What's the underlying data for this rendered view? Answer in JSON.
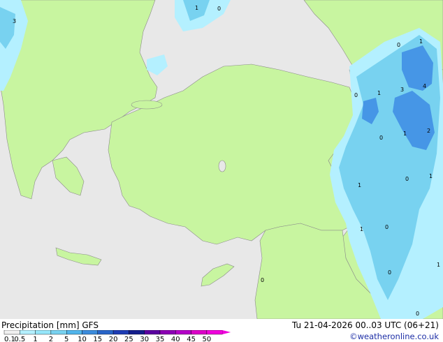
{
  "map": {
    "point_values": [
      {
        "label": "3",
        "lon_lat_hint": "north-west corner"
      },
      {
        "label": "1",
        "lon_lat_hint": "black sea west"
      },
      {
        "label": "0",
        "lon_lat_hint": "black sea west"
      },
      {
        "label": "0",
        "lon_lat_hint": "caucasus"
      },
      {
        "label": "1",
        "lon_lat_hint": "caucasus"
      },
      {
        "label": "1",
        "lon_lat_hint": "caucasus"
      },
      {
        "label": "3",
        "lon_lat_hint": "caucasus"
      },
      {
        "label": "4",
        "lon_lat_hint": "caucasus"
      },
      {
        "label": "0",
        "lon_lat_hint": "eastern turkey"
      },
      {
        "label": "2",
        "lon_lat_hint": "caspian"
      },
      {
        "label": "1",
        "lon_lat_hint": "armenia"
      },
      {
        "label": "0",
        "lon_lat_hint": "armenia"
      },
      {
        "label": "0",
        "lon_lat_hint": "iran"
      },
      {
        "label": "1",
        "lon_lat_hint": "iran"
      },
      {
        "label": "1",
        "lon_lat_hint": "iraq"
      },
      {
        "label": "1",
        "lon_lat_hint": "iraq"
      },
      {
        "label": "0",
        "lon_lat_hint": "iraq"
      },
      {
        "label": "0",
        "lon_lat_hint": "levant"
      },
      {
        "label": "0",
        "lon_lat_hint": "iraq south"
      },
      {
        "label": "1",
        "lon_lat_hint": "iran south"
      },
      {
        "label": "0",
        "lon_lat_hint": "south-east corner"
      }
    ],
    "colors": {
      "sea": "#e8e8e8",
      "land": "#c8f5a0",
      "precip_light": "#b4f0ff",
      "precip_mid": "#78d2f0",
      "precip_heavy": "#4696e6"
    }
  },
  "footer": {
    "title": "Precipitation [mm]  GFS",
    "datetime": "Tu 21-04-2026 00..03 UTC (06+21)",
    "credit": "©weatheronline.co.uk",
    "scale_labels": [
      "0.1",
      "0.5",
      "1",
      "2",
      "5",
      "10",
      "15",
      "20",
      "25",
      "30",
      "35",
      "40",
      "45",
      "50"
    ],
    "scale_colors": [
      "#f0f0f0",
      "#b4f0ff",
      "#96e6fa",
      "#78d2f0",
      "#50b4eb",
      "#3c8cdc",
      "#2864c8",
      "#1e3cb4",
      "#141e8c",
      "#5a00a0",
      "#8c00b4",
      "#b400c8",
      "#dc00c8",
      "#f000dc"
    ]
  }
}
